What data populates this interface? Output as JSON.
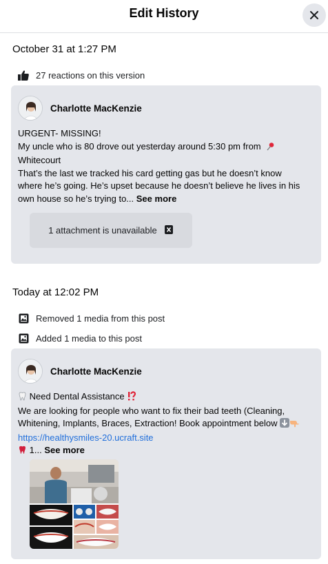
{
  "header": {
    "title": "Edit History",
    "close_icon": "close-icon"
  },
  "versions": [
    {
      "date": "October 31 at 1:27 PM",
      "meta": [
        {
          "icon": "thumbs-up-icon",
          "text": "27 reactions on this version"
        }
      ],
      "author": "Charlotte MacKenzie",
      "text_lines": [
        "URGENT- MISSING!",
        "My uncle who is 80 drove out yesterday around 5:30 pm from",
        "Whitecourt",
        "That’s the last we tracked his card getting gas but he doesn’t know",
        "where he’s going.  He’s upset because he doesn’t believe he lives in his",
        "own house so he’s trying to..."
      ],
      "see_more": "See more",
      "attachment": {
        "text": "1 attachment is unavailable",
        "icon": "unavailable-attachment-icon"
      }
    },
    {
      "date": "Today at 12:02 PM",
      "meta": [
        {
          "icon": "media-icon",
          "text": "Removed 1 media from this post"
        },
        {
          "icon": "media-icon",
          "text": "Added 1 media to this post"
        }
      ],
      "author": "Charlotte MacKenzie",
      "text_lines": [
        " Need Dental Assistance ",
        "We are looking for people who want to fix their bad teeth (Cleaning,",
        "Whitening, Implants, Braces, Extraction! Book appointment below ",
        "https://healthysmiles-20.ucraft.site",
        " 1..."
      ],
      "see_more": "See more",
      "media": {
        "description_icon": "dental-collage-image"
      }
    }
  ],
  "colors": {
    "card_bg": "#e4e6eb",
    "link": "#216fdb",
    "text": "#050505"
  }
}
